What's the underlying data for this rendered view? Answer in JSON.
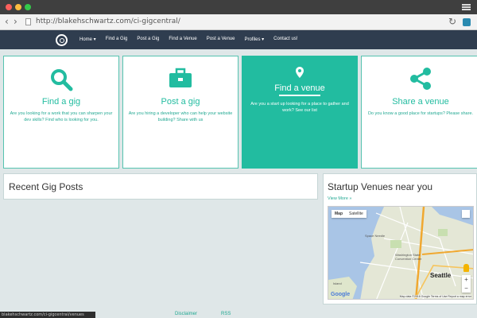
{
  "browser": {
    "url": "http://blakehschwartz.com/ci-gigcentral/",
    "status_url": "blakehschwartz.com/ci-gigcentral/venues",
    "icons": [
      "back-icon",
      "forward-icon",
      "page-icon",
      "reload-icon",
      "extension-icon",
      "menu-icon"
    ]
  },
  "nav": {
    "links": [
      "Home ▾",
      "Find a Gig",
      "Post a Gig",
      "Find a Venue",
      "Post a Venue",
      "Profiles ▾",
      "Contact us!"
    ]
  },
  "cards": [
    {
      "title": "Find a gig",
      "desc": "Are you looking for a work that you can sharpen your dev skills? Find who is looking for you.",
      "icon": "search-icon"
    },
    {
      "title": "Post a gig",
      "desc": "Are you hiring a developer who can help your website building? Share with us",
      "icon": "briefcase-icon"
    },
    {
      "title": "Find a venue",
      "desc": "Are you a start up looking for a place to gather and work? See our list",
      "icon": "map-pin-icon"
    },
    {
      "title": "Share a venue",
      "desc": "Do you know a good place for startups? Please share.",
      "icon": "share-icon"
    }
  ],
  "recent": {
    "title": "Recent Gig Posts"
  },
  "venues": {
    "title": "Startup Venues near you",
    "view_more": "View More »",
    "map": {
      "type_options": [
        "Map",
        "Satellite"
      ],
      "selected": "Map",
      "city": "Seattle",
      "labels": [
        "Space Needle",
        "Washington State Convention Center",
        "Island"
      ],
      "logo": "Google",
      "footer": "Map data ©2016 Google  Terms of Use  Report a map error",
      "zoom": [
        "+",
        "−"
      ]
    }
  },
  "footer": {
    "links": [
      "Disclaimer",
      "RSS"
    ]
  },
  "colors": {
    "accent": "#22bca0",
    "navbar": "#2f3d4f",
    "background": "#dfe7e8"
  }
}
